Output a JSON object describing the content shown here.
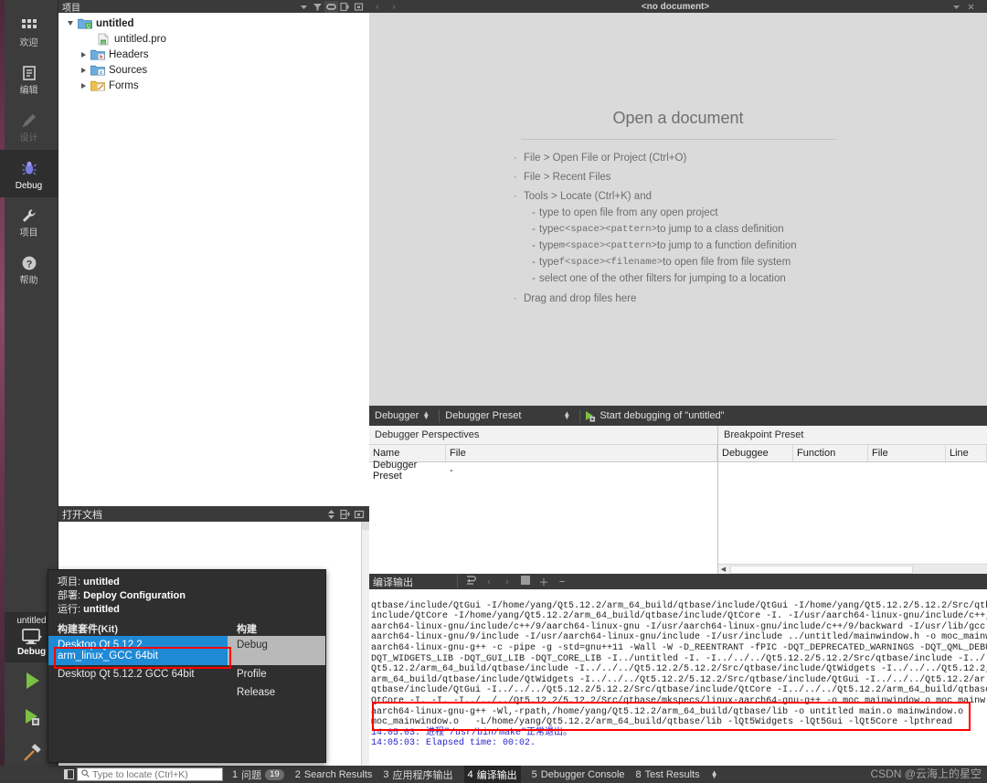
{
  "sidebar": {
    "modes": [
      {
        "label": "欢迎",
        "icon": "grid-icon",
        "state": "normal"
      },
      {
        "label": "编辑",
        "icon": "document-icon",
        "state": "normal"
      },
      {
        "label": "设计",
        "icon": "pencil-icon",
        "state": "disabled"
      },
      {
        "label": "Debug",
        "icon": "bug-icon",
        "state": "active"
      },
      {
        "label": "项目",
        "icon": "wrench-icon",
        "state": "normal"
      },
      {
        "label": "帮助",
        "icon": "question-icon",
        "state": "normal"
      }
    ],
    "kit_button": {
      "project": "untitled",
      "build_config": "Debug",
      "icon": "monitor-icon"
    },
    "run_buttons": [
      {
        "name": "run-button",
        "icon": "play-green-icon"
      },
      {
        "name": "debug-button",
        "icon": "play-debug-icon"
      },
      {
        "name": "build-button",
        "icon": "hammer-icon"
      }
    ]
  },
  "project_panel": {
    "title": "项目",
    "toolbar_icons": [
      "filter-icon",
      "sync-icon",
      "link-icon",
      "split-icon",
      "close-icon"
    ],
    "tree": [
      {
        "label": "untitled",
        "indent": 0,
        "expanded": true,
        "bold": true,
        "icon": "project-folder-icon"
      },
      {
        "label": "untitled.pro",
        "indent": 1,
        "expanded": null,
        "bold": false,
        "icon": "pro-file-icon"
      },
      {
        "label": "Headers",
        "indent": 1,
        "expanded": false,
        "bold": false,
        "icon": "headers-folder-icon"
      },
      {
        "label": "Sources",
        "indent": 1,
        "expanded": false,
        "bold": false,
        "icon": "sources-folder-icon"
      },
      {
        "label": "Forms",
        "indent": 1,
        "expanded": false,
        "bold": false,
        "icon": "forms-folder-icon"
      }
    ]
  },
  "open_documents_panel": {
    "title": "打开文档",
    "toolbar_icons": [
      "sort-icon",
      "split-icon",
      "close-icon"
    ],
    "items": []
  },
  "editor": {
    "tab_title": "<no document>",
    "nav_back": "‹",
    "nav_forward": "›",
    "toolbar_icons": [
      "chevron-down-icon",
      "close-icon"
    ],
    "welcome": {
      "heading": "Open a document",
      "bullets": [
        {
          "text": "File > Open File or Project (Ctrl+O)",
          "sub": []
        },
        {
          "text": "File > Recent Files",
          "sub": []
        },
        {
          "text": "Tools > Locate (Ctrl+K) and",
          "sub": [
            {
              "pre": "type to open file from any open project",
              "mono": "",
              "post": ""
            },
            {
              "pre": "type ",
              "mono": "c<space><pattern>",
              "post": " to jump to a class definition"
            },
            {
              "pre": "type ",
              "mono": "m<space><pattern>",
              "post": " to jump to a function definition"
            },
            {
              "pre": "type ",
              "mono": "f<space><filename>",
              "post": " to open file from file system"
            },
            {
              "pre": "select one of the other filters for jumping to a location",
              "mono": "",
              "post": ""
            }
          ]
        },
        {
          "text": "Drag and drop files here",
          "sub": []
        }
      ]
    }
  },
  "debugger_panel": {
    "toolbar": {
      "mode_selector": "Debugger",
      "preset_selector": "Debugger Preset",
      "action_label": "Start debugging of \"untitled\"",
      "action_icon": "start-debug-icon"
    },
    "perspectives": {
      "title": "Debugger Perspectives",
      "columns": [
        "Name",
        "File"
      ],
      "rows": [
        [
          "Debugger Preset",
          "-"
        ]
      ]
    },
    "breakpoints": {
      "title": "Breakpoint Preset",
      "columns": [
        "Debuggee",
        "Function",
        "File",
        "Line"
      ],
      "rows": []
    }
  },
  "compile_output": {
    "title": "编译输出",
    "toolbar_icons": [
      "wrap-lines-icon",
      "prev-icon",
      "next-icon",
      "stop-icon",
      "zoom-in-icon",
      "zoom-out-icon"
    ],
    "lines": [
      "qtbase/include/QtGui -I/home/yang/Qt5.12.2/arm_64_build/qtbase/include/QtGui -I/home/yang/Qt5.12.2/5.12.2/Src/qtb",
      "include/QtCore -I/home/yang/Qt5.12.2/arm_64_build/qtbase/include/QtCore -I. -I/usr/aarch64-linux-gnu/include/c++,",
      "aarch64-linux-gnu/include/c++/9/aarch64-linux-gnu -I/usr/aarch64-linux-gnu/include/c++/9/backward -I/usr/lib/gcc-",
      "aarch64-linux-gnu/9/include -I/usr/aarch64-linux-gnu/include -I/usr/include ../untitled/mainwindow.h -o moc_mainw",
      "aarch64-linux-gnu-g++ -c -pipe -g -std=gnu++11 -Wall -W -D_REENTRANT -fPIC -DQT_DEPRECATED_WARNINGS -DQT_QML_DEBU",
      "DQT_WIDGETS_LIB -DQT_GUI_LIB -DQT_CORE_LIB -I../untitled -I. -I../../../Qt5.12.2/5.12.2/Src/qtbase/include -I../",
      "Qt5.12.2/arm_64_build/qtbase/include -I../../../Qt5.12.2/5.12.2/Src/qtbase/include/QtWidgets -I../../../Qt5.12.2,",
      "arm_64_build/qtbase/include/QtWidgets -I../../../Qt5.12.2/5.12.2/Src/qtbase/include/QtGui -I../../../Qt5.12.2/ar",
      "qtbase/include/QtGui -I../../../Qt5.12.2/5.12.2/Src/qtbase/include/QtCore -I../../../Qt5.12.2/arm_64_build/qtbase",
      "QtCore -I. -I. -I../../../Qt5.12.2/5.12.2/Src/qtbase/mkspecs/linux-aarch64-gnu-g++ -o moc_mainwindow.o moc_mainw",
      "aarch64-linux-gnu-g++ -Wl,-rpath,/home/yang/Qt5.12.2/arm_64_build/qtbase/lib -o untitled main.o mainwindow.o",
      "moc_mainwindow.o   -L/home/yang/Qt5.12.2/arm_64_build/qtbase/lib -lQt5Widgets -lQt5Gui -lQt5Core -lpthread"
    ],
    "status_lines": [
      "14:05:03: 进程\"/usr/bin/make\"正常退出。",
      "14:05:03: Elapsed time: 00:02."
    ]
  },
  "kit_popup": {
    "project_label": "项目:",
    "project_value": "untitled",
    "deploy_label": "部署:",
    "deploy_value": "Deploy Configuration",
    "run_label": "运行:",
    "run_value": "untitled",
    "kit_column_header": "构建套件(Kit)",
    "build_column_header": "构建",
    "kits": [
      {
        "label": "Desktop Qt 5.12.2 arm_linux_GCC 64bit",
        "selected": true
      },
      {
        "label": "Desktop Qt 5.12.2 GCC 64bit",
        "selected": false
      }
    ],
    "builds": [
      {
        "label": "Debug",
        "selected": true
      },
      {
        "label": "Profile",
        "selected": false
      },
      {
        "label": "Release",
        "selected": false
      }
    ]
  },
  "status_bar": {
    "toggle_sidebar_icon": "sidebar-toggle-icon",
    "locate_placeholder": "Type to locate (Ctrl+K)",
    "locate_value": "",
    "items": [
      {
        "num": "1",
        "label": "问题",
        "badge": "19",
        "selected": false
      },
      {
        "num": "2",
        "label": "Search Results",
        "badge": "",
        "selected": false
      },
      {
        "num": "3",
        "label": "应用程序输出",
        "badge": "",
        "selected": false
      },
      {
        "num": "4",
        "label": "编译输出",
        "badge": "",
        "selected": true
      },
      {
        "num": "5",
        "label": "Debugger Console",
        "badge": "",
        "selected": false
      },
      {
        "num": "8",
        "label": "Test Results",
        "badge": "",
        "selected": false
      }
    ]
  },
  "watermark": "CSDN @云海上的星空",
  "colors": {
    "accent_blue": "#1e8ad6",
    "highlight_red": "#ff0000",
    "panel_dark": "#3a3a3a",
    "mode_active": "#2e2e2e"
  }
}
